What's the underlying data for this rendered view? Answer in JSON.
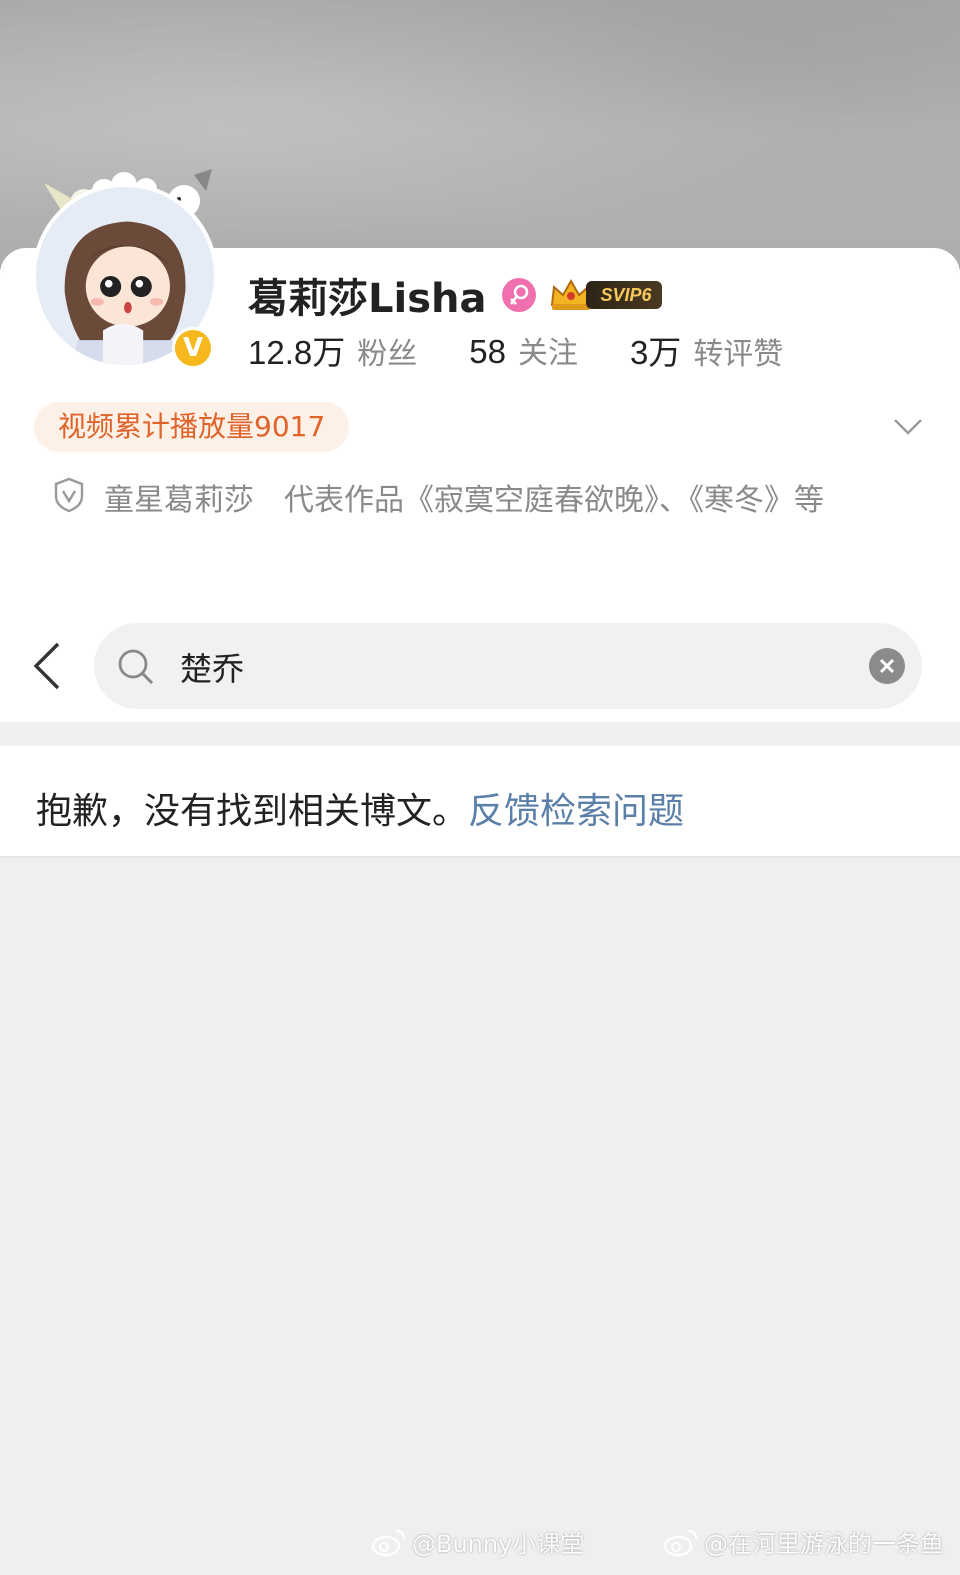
{
  "profile": {
    "name": "葛莉莎Lisha",
    "svip_label": "SVIP6",
    "verified_badge": "V",
    "stats": [
      {
        "value": "12.8万",
        "label": "粉丝"
      },
      {
        "value": "58",
        "label": "关注"
      },
      {
        "value": "3万",
        "label": "转评赞"
      }
    ],
    "play_count_label": "视频累计播放量9017",
    "bio": "童星葛莉莎　代表作品《寂寞空庭春欲晚》、《寒冬》等"
  },
  "search": {
    "query": "楚乔"
  },
  "result": {
    "message": "抱歉，没有找到相关博文。",
    "feedback_link": "反馈检索问题"
  },
  "watermarks": [
    {
      "text": "@Bunny小课堂"
    },
    {
      "text": "@在河里游泳的一条鱼"
    }
  ],
  "colors": {
    "accent_orange": "#e0642a",
    "link_blue": "#5a7fa8",
    "verified_gold": "#f7b81d",
    "gender_pink": "#f06fae"
  },
  "icons": [
    "gender-female-icon",
    "svip-crown-icon",
    "chevron-down-icon",
    "shield-verified-icon",
    "back-arrow-icon",
    "search-icon",
    "clear-icon",
    "weibo-logo-icon"
  ]
}
